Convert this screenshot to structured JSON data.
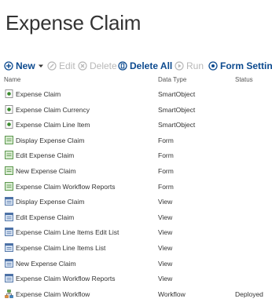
{
  "page": {
    "title": "Expense Claim"
  },
  "toolbar": {
    "new_label": "New",
    "edit_label": "Edit",
    "delete_label": "Delete",
    "delete_all_label": "Delete All",
    "run_label": "Run",
    "form_settings_label": "Form Settings"
  },
  "columns": {
    "name": "Name",
    "data_type": "Data Type",
    "status": "Status"
  },
  "rows": [
    {
      "name": "Expense Claim",
      "data_type": "SmartObject",
      "status": "",
      "icon": "smartobject-icon"
    },
    {
      "name": "Expense Claim Currency",
      "data_type": "SmartObject",
      "status": "",
      "icon": "smartobject-icon"
    },
    {
      "name": "Expense Claim Line Item",
      "data_type": "SmartObject",
      "status": "",
      "icon": "smartobject-icon"
    },
    {
      "name": "Display Expense Claim",
      "data_type": "Form",
      "status": "",
      "icon": "form-icon"
    },
    {
      "name": "Edit Expense Claim",
      "data_type": "Form",
      "status": "",
      "icon": "form-icon"
    },
    {
      "name": "New Expense Claim",
      "data_type": "Form",
      "status": "",
      "icon": "form-icon"
    },
    {
      "name": "Expense Claim Workflow Reports",
      "data_type": "Form",
      "status": "",
      "icon": "form-icon"
    },
    {
      "name": "Display Expense Claim",
      "data_type": "View",
      "status": "",
      "icon": "view-icon"
    },
    {
      "name": "Edit Expense Claim",
      "data_type": "View",
      "status": "",
      "icon": "view-icon"
    },
    {
      "name": "Expense Claim Line Items Edit List",
      "data_type": "View",
      "status": "",
      "icon": "view-icon"
    },
    {
      "name": "Expense Claim Line Items List",
      "data_type": "View",
      "status": "",
      "icon": "view-icon"
    },
    {
      "name": "New Expense Claim",
      "data_type": "View",
      "status": "",
      "icon": "view-icon"
    },
    {
      "name": "Expense Claim Workflow Reports",
      "data_type": "View",
      "status": "",
      "icon": "view-icon"
    },
    {
      "name": "Expense Claim Workflow",
      "data_type": "Workflow",
      "status": "Deployed",
      "icon": "workflow-icon"
    }
  ],
  "colors": {
    "accent": "#0c4a8f",
    "disabled": "#b8b8b8",
    "text": "#333333"
  }
}
